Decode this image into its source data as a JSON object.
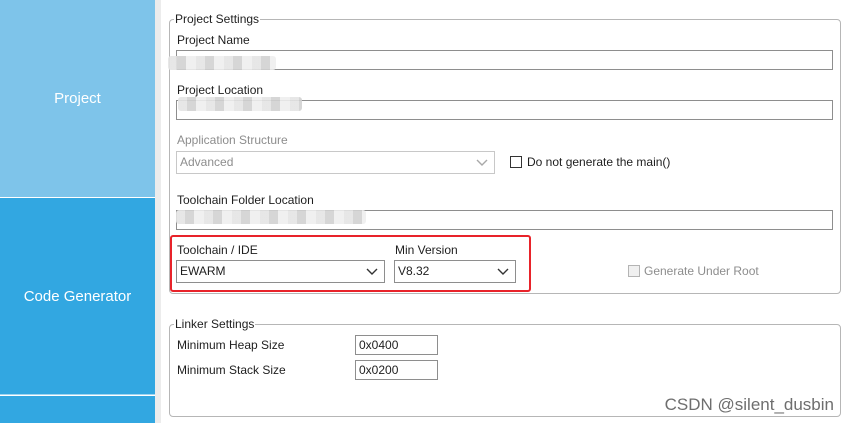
{
  "sidebar": {
    "tabs": [
      {
        "label": "Project"
      },
      {
        "label": "Code Generator"
      }
    ]
  },
  "project_settings": {
    "legend": "Project Settings",
    "project_name": {
      "label": "Project Name",
      "value": ""
    },
    "project_location": {
      "label": "Project Location",
      "value": ""
    },
    "application_structure": {
      "label": "Application Structure",
      "value": "Advanced"
    },
    "no_main": {
      "label": "Do not generate the main()",
      "checked": false
    },
    "toolchain_folder": {
      "label": "Toolchain Folder Location",
      "value": ""
    },
    "toolchain_ide": {
      "label": "Toolchain / IDE",
      "value": "EWARM"
    },
    "min_version": {
      "label": "Min Version",
      "value": "V8.32"
    },
    "generate_under_root": {
      "label": "Generate Under Root",
      "checked": false
    }
  },
  "linker_settings": {
    "legend": "Linker Settings",
    "min_heap": {
      "label": "Minimum Heap Size",
      "value": "0x0400"
    },
    "min_stack": {
      "label": "Minimum Stack Size",
      "value": "0x0200"
    }
  },
  "watermark": "CSDN @silent_dusbin",
  "colors": {
    "sidebar_active": "#7ec4ea",
    "sidebar_inactive": "#32a7e1",
    "highlight": "#e8232a"
  }
}
